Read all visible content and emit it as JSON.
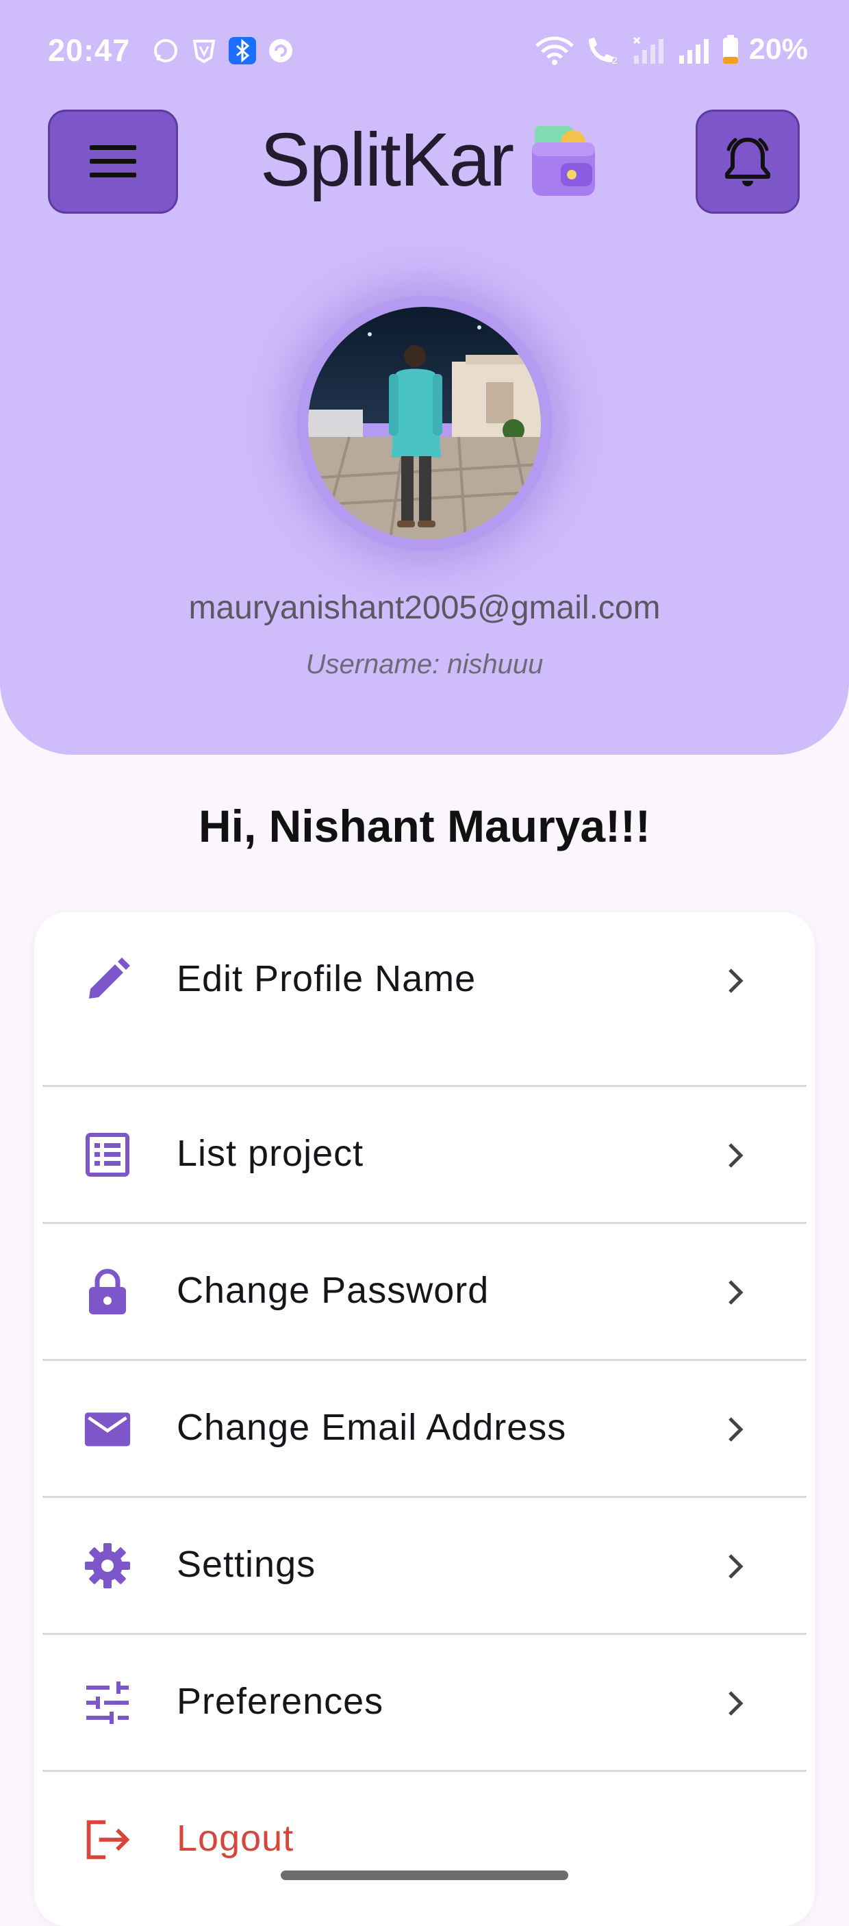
{
  "status_bar": {
    "time": "20:47",
    "battery": "20%"
  },
  "header": {
    "app_title": "SplitKar",
    "menu_icon": "hamburger-icon",
    "bell_icon": "bell-icon",
    "logo_icon": "wallet-icon"
  },
  "profile": {
    "email": "mauryanishant2005@gmail.com",
    "username": "Username: nishuuu",
    "greeting": "Hi, Nishant Maurya!!!"
  },
  "menu": {
    "items": [
      {
        "label": "Edit Profile Name",
        "icon": "pencil-icon"
      },
      {
        "label": "List project",
        "icon": "list-icon"
      },
      {
        "label": "Change Password",
        "icon": "lock-icon"
      },
      {
        "label": "Change Email Address",
        "icon": "mail-icon"
      },
      {
        "label": "Settings",
        "icon": "gear-icon"
      },
      {
        "label": "Preferences",
        "icon": "sliders-icon"
      },
      {
        "label": "Logout",
        "icon": "logout-icon"
      }
    ]
  },
  "colors": {
    "header_bg": "#cfbcfb",
    "accent": "#7d56c9",
    "page_bg": "#fbf5fd",
    "logout": "#d8453a"
  }
}
